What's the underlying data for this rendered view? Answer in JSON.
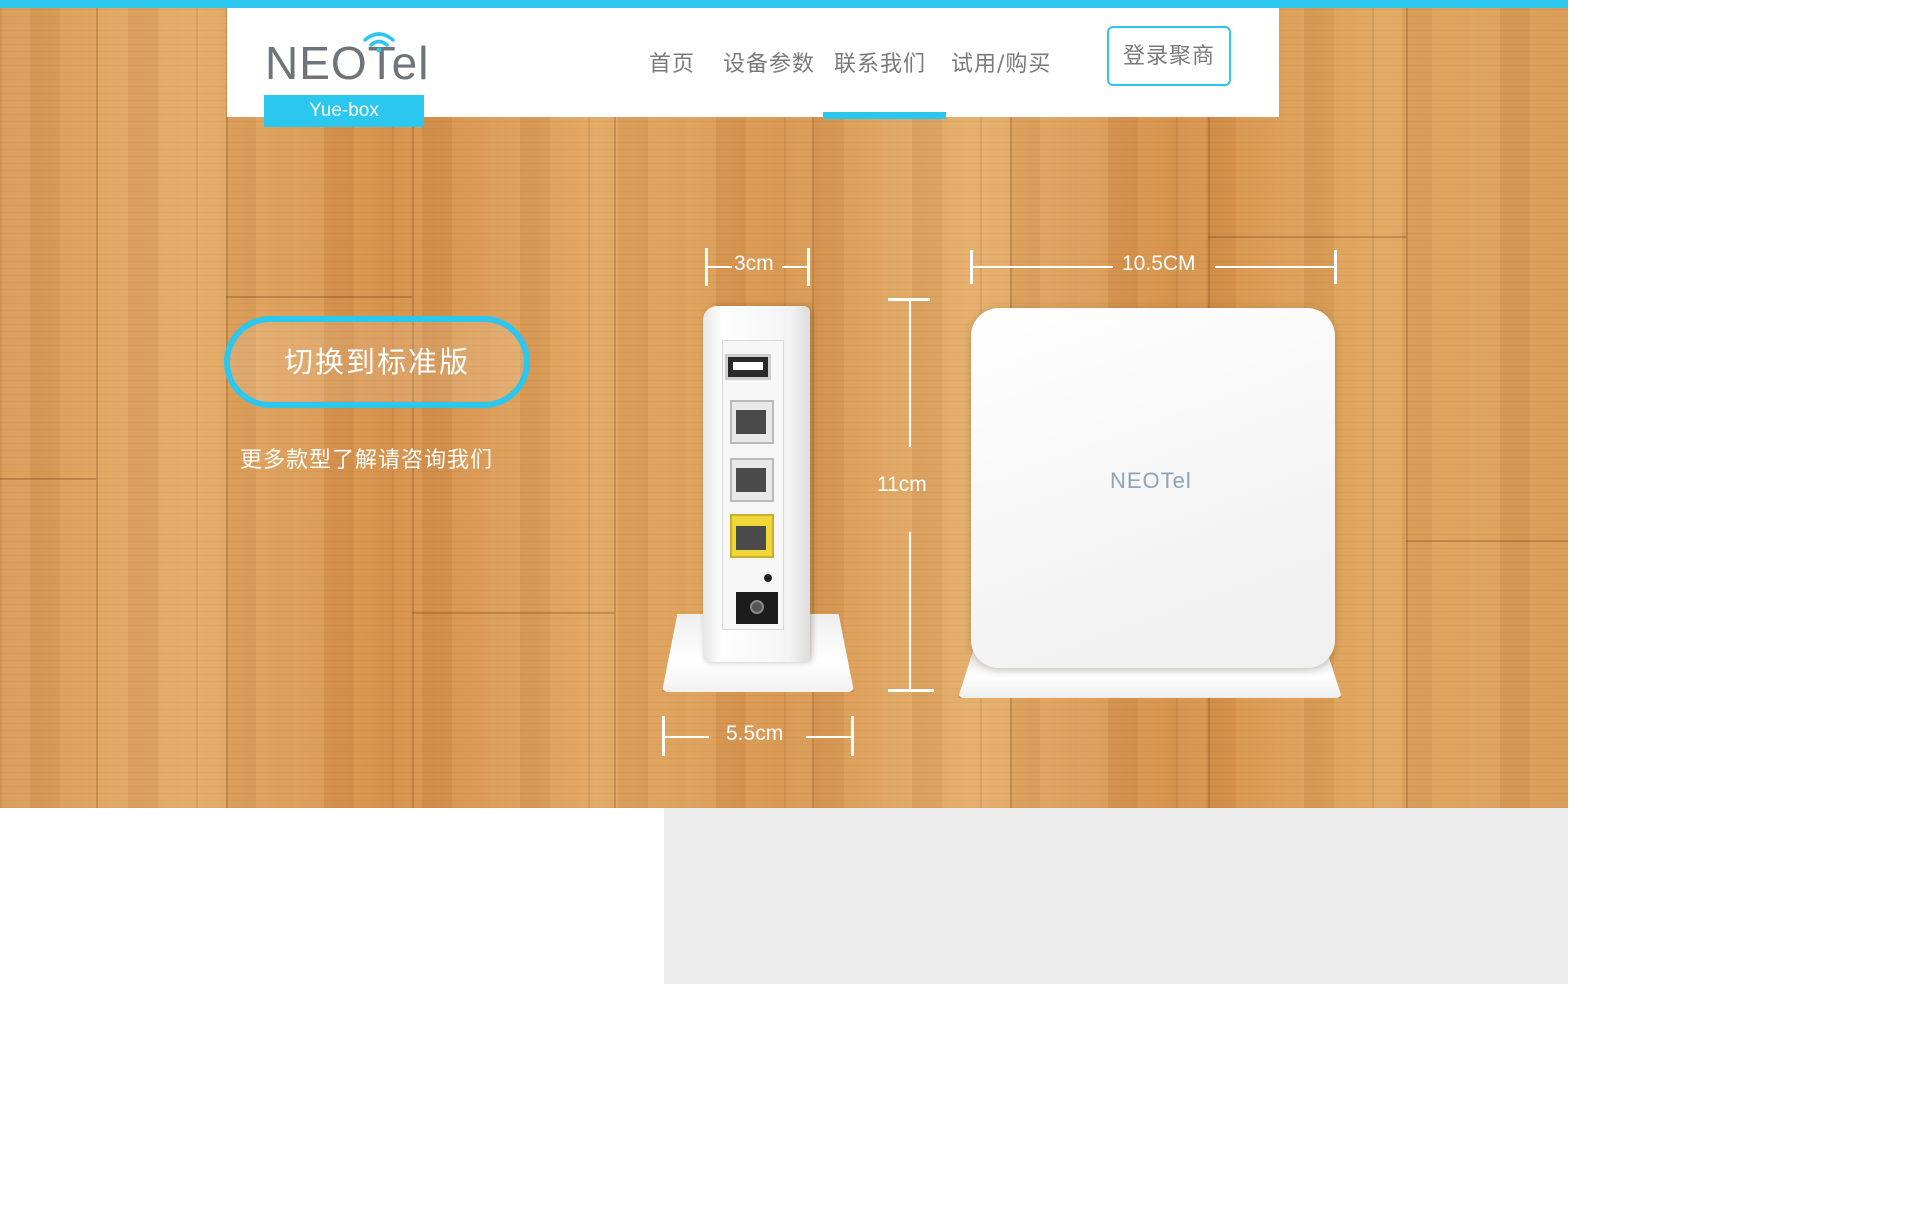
{
  "brand": {
    "logo_text": "NEOTel",
    "badge": "Yue-box",
    "accent_color": "#2bc7ee"
  },
  "nav": {
    "items": [
      {
        "label": "首页",
        "active": false
      },
      {
        "label": "设备参数",
        "active": false
      },
      {
        "label": "联系我们",
        "active": true
      },
      {
        "label": "试用/购买",
        "active": false
      }
    ],
    "login_label": "登录聚商"
  },
  "hero": {
    "switch_button": "切换到标准版",
    "more_text": "更多款型了解请咨询我们",
    "device_logo": "NEOTel",
    "dimensions": {
      "side_depth": "3cm",
      "front_width": "10.5CM",
      "height": "11cm",
      "base_depth": "5.5cm"
    },
    "icons": [
      "wifi-icon"
    ]
  }
}
